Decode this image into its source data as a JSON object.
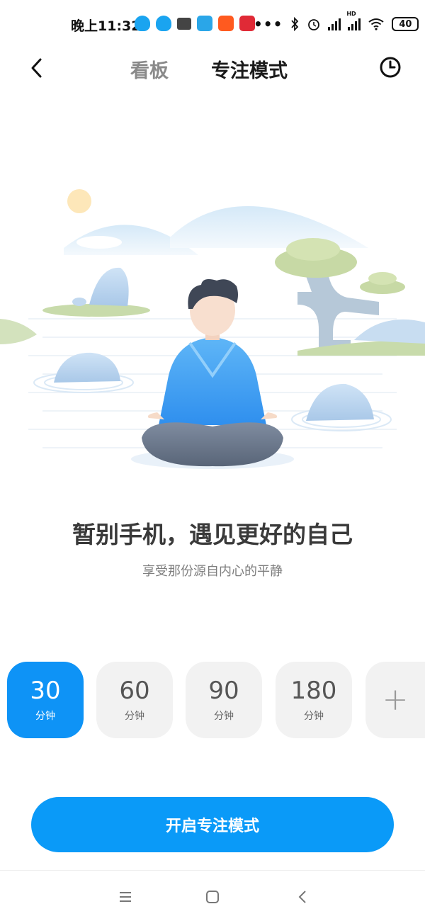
{
  "status_bar": {
    "time": "晚上11:32",
    "dots": "•••",
    "battery": "40",
    "hd": "HD"
  },
  "header": {
    "tab_board": "看板",
    "tab_focus": "专注模式"
  },
  "main": {
    "headline": "暂别手机，遇见更好的自己",
    "subline": "享受那份源自内心的平静"
  },
  "options": [
    {
      "value": "30",
      "unit": "分钟"
    },
    {
      "value": "60",
      "unit": "分钟"
    },
    {
      "value": "90",
      "unit": "分钟"
    },
    {
      "value": "180",
      "unit": "分钟"
    },
    {
      "value": "+"
    }
  ],
  "start_button": "开启专注模式",
  "colors": {
    "accent": "#0e93f6",
    "button": "#0a9af8"
  }
}
